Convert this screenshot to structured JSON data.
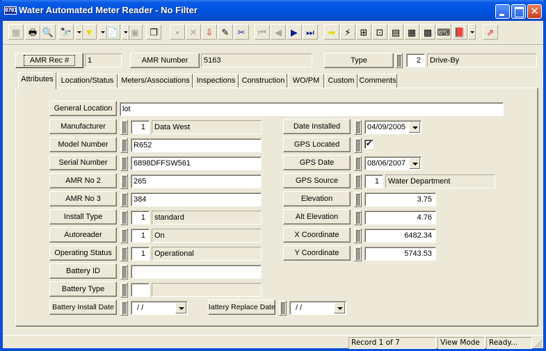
{
  "window": {
    "title": "Water Automated Meter Reader - No Filter",
    "app_icon_text": "0701",
    "controls": {
      "minimize": "minimize",
      "maximize": "maximize",
      "close": "✕"
    }
  },
  "toolbar": {
    "icons": [
      {
        "name": "new-record-icon",
        "glyph": "▦",
        "disabled": true
      },
      {
        "name": "print-icon",
        "glyph": "🖶",
        "disabled": false
      },
      {
        "name": "print-preview-icon",
        "glyph": "🔍",
        "disabled": false
      },
      {
        "name": "find-icon",
        "glyph": "🔭",
        "disabled": false,
        "dropdown": true
      },
      {
        "name": "filter-icon",
        "glyph": "▼",
        "disabled": false,
        "dropdown": true,
        "color": "#E8D800"
      },
      {
        "name": "report-icon",
        "glyph": "📄",
        "disabled": false,
        "dropdown": true
      },
      {
        "name": "edit-properties-icon",
        "glyph": "▣",
        "disabled": true
      },
      {
        "name": "copy-document-icon",
        "glyph": "❐",
        "disabled": false
      },
      {
        "name": "save-icon",
        "glyph": "▪",
        "disabled": true
      },
      {
        "name": "delete-icon",
        "glyph": "✕",
        "disabled": true
      },
      {
        "name": "import-icon",
        "glyph": "⇩",
        "disabled": false,
        "color": "#D02020"
      },
      {
        "name": "edit-pencil-icon",
        "glyph": "✎",
        "disabled": false
      },
      {
        "name": "cut-icon",
        "glyph": "✂",
        "disabled": false,
        "color": "#1A2A9A"
      },
      {
        "name": "first-record-icon",
        "glyph": "⏮",
        "disabled": true
      },
      {
        "name": "previous-record-icon",
        "glyph": "◀",
        "disabled": true
      },
      {
        "name": "next-record-icon",
        "glyph": "▶",
        "disabled": false,
        "color": "#0A1E8A"
      },
      {
        "name": "last-record-icon",
        "glyph": "⏭",
        "disabled": false,
        "color": "#0A1E8A"
      },
      {
        "name": "go-to-icon",
        "glyph": "➡",
        "disabled": false,
        "color": "#E8D800"
      },
      {
        "name": "lightning-icon",
        "glyph": "⚡",
        "disabled": false
      },
      {
        "name": "hierarchy-icon",
        "glyph": "⊞",
        "disabled": false
      },
      {
        "name": "relationship-icon",
        "glyph": "⊡",
        "disabled": false
      },
      {
        "name": "equipment-icon",
        "glyph": "▤",
        "disabled": false
      },
      {
        "name": "calculator-icon",
        "glyph": "▦",
        "disabled": false
      },
      {
        "name": "map-icon",
        "glyph": "▩",
        "disabled": false
      },
      {
        "name": "keyboard-icon",
        "glyph": "⌨",
        "disabled": false
      },
      {
        "name": "help-book-icon",
        "glyph": "📕",
        "disabled": false,
        "dropdown": true,
        "color": "#7A2A9A"
      },
      {
        "name": "exit-icon",
        "glyph": "⇗",
        "disabled": false,
        "color": "#D02020"
      }
    ]
  },
  "header": {
    "amr_rec_label": "AMR Rec #",
    "amr_rec_value": "1",
    "amr_number_label": "AMR Number",
    "amr_number_value": "5163",
    "type_label": "Type",
    "type_code": "2",
    "type_value": "Drive-By"
  },
  "tabs": [
    {
      "label": "Attributes",
      "active": true
    },
    {
      "label": "Location/Status"
    },
    {
      "label": "Meters/Associations"
    },
    {
      "label": "Inspections"
    },
    {
      "label": "Construction"
    },
    {
      "label": "WO/PM"
    },
    {
      "label": "Custom"
    },
    {
      "label": "Comments"
    }
  ],
  "attributes": {
    "general_location": {
      "label": "General Location",
      "value": "lot"
    },
    "manufacturer": {
      "label": "Manufacturer",
      "code": "1",
      "value": "Data West"
    },
    "model_number": {
      "label": "Model Number",
      "value": "R652"
    },
    "serial_number": {
      "label": "Serial Number",
      "value": "6898DFFSW561"
    },
    "amr_no_2": {
      "label": "AMR No 2",
      "value": "265"
    },
    "amr_no_3": {
      "label": "AMR No 3",
      "value": "384"
    },
    "install_type": {
      "label": "Install Type",
      "code": "1",
      "value": "standard"
    },
    "autoreader": {
      "label": "Autoreader",
      "code": "1",
      "value": "On"
    },
    "operating_status": {
      "label": "Operating Status",
      "code": "1",
      "value": "Operational"
    },
    "battery_id": {
      "label": "Battery ID",
      "value": ""
    },
    "battery_type": {
      "label": "Battery Type",
      "code": "",
      "value": ""
    },
    "battery_install_date": {
      "label": "Battery Install Date",
      "value": " /  /"
    },
    "battery_replace_date": {
      "label": "Battery Replace Date",
      "value": " /  /"
    },
    "date_installed": {
      "label": "Date Installed",
      "value": "04/09/2005"
    },
    "gps_located": {
      "label": "GPS Located",
      "checked": true,
      "check_glyph": "✔"
    },
    "gps_date": {
      "label": "GPS Date",
      "value": "08/06/2007"
    },
    "gps_source": {
      "label": "GPS Source",
      "code": "1",
      "value": "Water Department"
    },
    "elevation": {
      "label": "Elevation",
      "value": "3.75"
    },
    "alt_elevation": {
      "label": "Alt Elevation",
      "value": "4.76"
    },
    "x_coordinate": {
      "label": "X Coordinate",
      "value": "6482.34"
    },
    "y_coordinate": {
      "label": "Y Coordinate",
      "value": "5743.53"
    }
  },
  "status_bar": {
    "record": "Record 1 of 7",
    "mode": "View Mode",
    "state": "Ready..."
  }
}
